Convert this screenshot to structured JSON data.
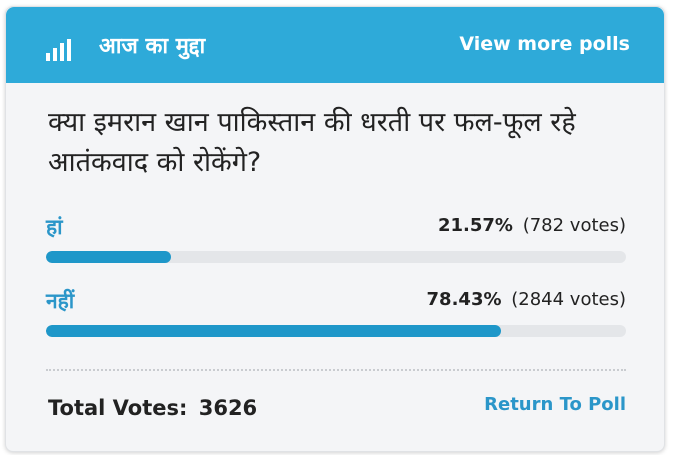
{
  "header": {
    "title": "आज का मुद्दा",
    "icon": "bar-chart-icon",
    "more_polls_label": "View more polls"
  },
  "poll": {
    "question": "क्या इमरान खान पाकिस्तान की धरती पर फल-फूल रहे आतंकवाद को रोकेंगे?",
    "options": [
      {
        "label": "हां",
        "percent_text": "21.57%",
        "votes_text": "(782 votes)",
        "percent": 21.57
      },
      {
        "label": "नहीं",
        "percent_text": "78.43%",
        "votes_text": "(2844 votes)",
        "percent": 78.43
      }
    ],
    "total_label": "Total Votes:",
    "total_votes": "3626",
    "return_label": "Return To Poll"
  },
  "colors": {
    "header_bg": "#2eaad9",
    "accent": "#2b96c9",
    "bar_fill": "#1e97c9",
    "bar_track": "#e4e6e9",
    "card_bg": "#f4f5f7"
  }
}
